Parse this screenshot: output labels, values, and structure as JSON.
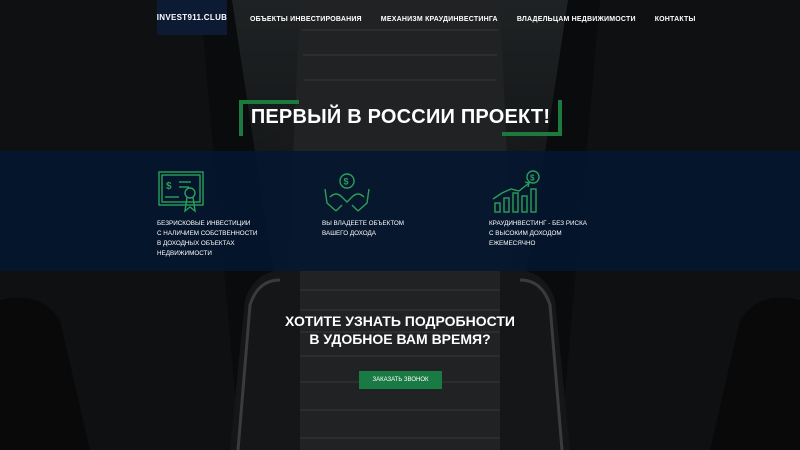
{
  "header": {
    "logo": "INVEST911.CLUB",
    "nav": [
      {
        "label": "ОБЪЕКТЫ ИНВЕСТИРОВАНИЯ"
      },
      {
        "label": "МЕХАНИЗМ КРАУДИНВЕСТИНГА"
      },
      {
        "label": "ВЛАДЕЛЬЦАМ НЕДВИЖИМОСТИ"
      },
      {
        "label": "КОНТАКТЫ"
      }
    ]
  },
  "hero": {
    "title": "ПЕРВЫЙ В РОССИИ ПРОЕКТ!"
  },
  "features": [
    {
      "icon": "certificate-dollar-icon",
      "text": "БЕЗРИСКОВЫЕ ИНВЕСТИЦИИ\nС НАЛИЧИЕМ СОБСТВЕННОСТИ\nВ ДОХОДНЫХ ОБЪЕКТАХ\nНЕДВИЖИМОСТИ"
    },
    {
      "icon": "hands-money-icon",
      "text": "ВЫ ВЛАДЕЕТЕ ОБЪЕКТОМ\nВАШЕГО ДОХОДА"
    },
    {
      "icon": "growth-chart-dollar-icon",
      "text": "КРАУДИНВЕСТИНГ - БЕЗ РИСКА\nС ВЫСОКИМ ДОХОДОМ\nЕЖЕМЕСЯЧНО"
    }
  ],
  "cta": {
    "title": "ХОТИТЕ УЗНАТЬ ПОДРОБНОСТИ\nВ УДОБНОЕ ВАМ ВРЕМЯ?",
    "button": "ЗАКАЗАТЬ ЗВОНОК"
  },
  "colors": {
    "accent_green": "#1d7a3e",
    "band_navy": "#031630",
    "button_green": "#1a7a44",
    "icon_green": "#2aa05a"
  }
}
